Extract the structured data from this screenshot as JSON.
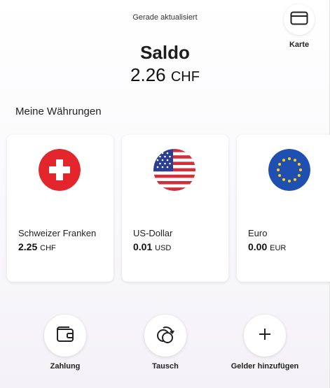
{
  "header": {
    "status": "Gerade aktualisiert",
    "card_button_label": "Karte",
    "card_icon": "credit-card-icon"
  },
  "balance": {
    "title": "Saldo",
    "amount": "2.26",
    "currency": "CHF"
  },
  "currencies_section": {
    "title": "Meine Währungen",
    "items": [
      {
        "name": "Schweizer Franken",
        "amount": "2.25",
        "code": "CHF",
        "flag_icon": "swiss-flag-icon"
      },
      {
        "name": "US-Dollar",
        "amount": "0.01",
        "code": "USD",
        "flag_icon": "us-flag-icon"
      },
      {
        "name": "Euro",
        "amount": "0.00",
        "code": "EUR",
        "flag_icon": "eu-flag-icon"
      }
    ]
  },
  "actions": [
    {
      "label": "Zahlung",
      "icon": "wallet-icon"
    },
    {
      "label": "Tausch",
      "icon": "exchange-icon"
    },
    {
      "label": "Gelder hinzufügen",
      "icon": "plus-icon"
    }
  ],
  "colors": {
    "swiss_red": "#e3262b",
    "us_red": "#d02f3c",
    "us_blue": "#2a3f8f",
    "eu_blue": "#1f4fb0",
    "eu_star": "#ffd400"
  }
}
